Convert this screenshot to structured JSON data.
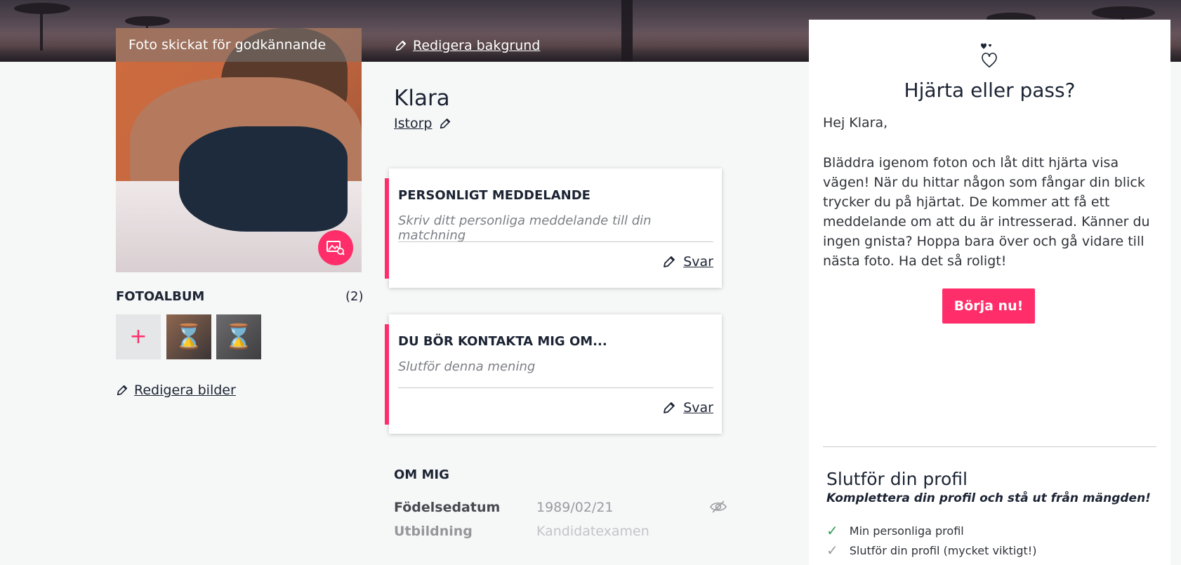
{
  "photo": {
    "banner_text": "Foto skickat för godkännande"
  },
  "background": {
    "edit_label": "Redigera bakgrund"
  },
  "profile": {
    "name": "Klara",
    "city": "Istorp"
  },
  "album": {
    "title": "FOTOALBUM",
    "count": "(2)",
    "add_symbol": "+",
    "pending_symbol": "⌛",
    "edit_label": "Redigera bilder"
  },
  "cards": [
    {
      "title": "PERSONLIGT MEDDELANDE",
      "placeholder": "Skriv ditt personliga meddelande till din matchning",
      "reply_label": "Svar"
    },
    {
      "title": "DU BÖR KONTAKTA MIG OM...",
      "placeholder": "Slutför denna mening",
      "reply_label": "Svar"
    }
  ],
  "about": {
    "title": "OM MIG",
    "rows": [
      {
        "label": "Födelsedatum",
        "value": "1989/02/21"
      },
      {
        "label": "Utbildning",
        "value": "Kandidatexamen"
      }
    ]
  },
  "panel": {
    "title": "Hjärta eller pass?",
    "greeting": "Hej Klara,",
    "body": "Bläddra igenom foton och låt ditt hjärta visa vägen! När du hittar någon som fångar din blick trycker du på hjärtat. De kommer att få ett meddelande om att du är intresserad. Känner du ingen gnista? Hoppa bara över och gå vidare till nästa foto. Ha det så roligt!",
    "start_label": "Börja nu!",
    "complete_title": "Slutför din profil",
    "complete_subtitle": "Komplettera din profil och stå ut från mängden!",
    "checklist": [
      {
        "label": "Min personliga profil",
        "done": true
      },
      {
        "label": "Slutför din profil (mycket viktigt!)",
        "done": false
      }
    ]
  },
  "colors": {
    "accent": "#ff2e6a",
    "check_done": "#35a055",
    "check_pending": "#9a9ca1"
  }
}
